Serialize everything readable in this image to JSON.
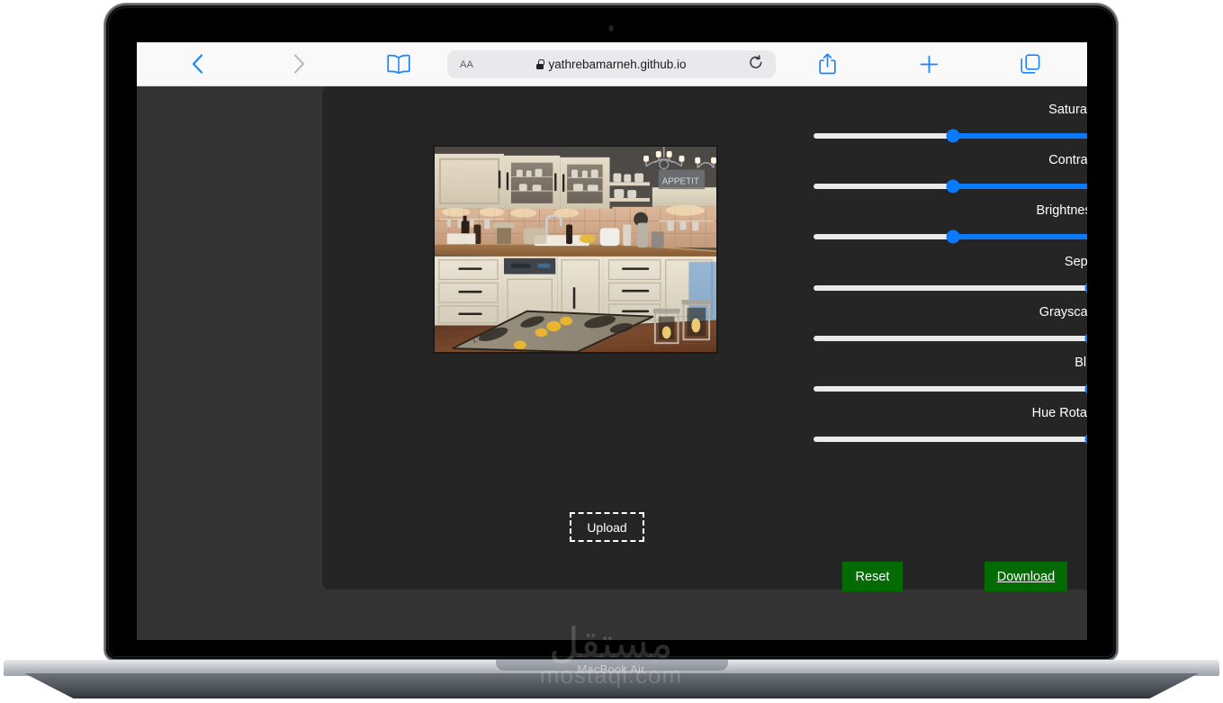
{
  "device": {
    "model_label": "MacBook Air",
    "camera_icon": "camera-dot-icon"
  },
  "watermark": {
    "arabic": "مستقل",
    "latin": "mostaql.com"
  },
  "browser": {
    "back_icon": "chevron-left-icon",
    "forward_icon": "chevron-right-icon",
    "bookmarks_icon": "book-icon",
    "share_icon": "share-icon",
    "new_tab_icon": "plus-icon",
    "tabs_icon": "tabs-overview-icon",
    "reload_icon": "reload-icon",
    "lock_icon": "lock-icon",
    "text_size_label": "AA",
    "url": "yathrebamarneh.github.io",
    "reload_glyph": "↻"
  },
  "editor": {
    "upload_label": "Upload",
    "reset_label": "Reset",
    "download_label": "Download",
    "accent_color": "#0a7bff",
    "button_color": "#046a04",
    "panel_color": "#252525",
    "page_color": "#333333",
    "image_alt": "kitchen-preview-image",
    "sliders": [
      {
        "label": "Saturate",
        "percent": 49,
        "fill_from_thumb": true
      },
      {
        "label": "Contrast",
        "percent": 49,
        "fill_from_thumb": true
      },
      {
        "label": "Brightness",
        "percent": 49,
        "fill_from_thumb": true
      },
      {
        "label": "Sepia",
        "percent": 100,
        "fill_from_thumb": false
      },
      {
        "label": "Grayscale",
        "percent": 100,
        "fill_from_thumb": false
      },
      {
        "label": "Blur",
        "percent": 100,
        "fill_from_thumb": false
      },
      {
        "label": "Hue Rotate",
        "percent": 100,
        "fill_from_thumb": false
      }
    ]
  }
}
